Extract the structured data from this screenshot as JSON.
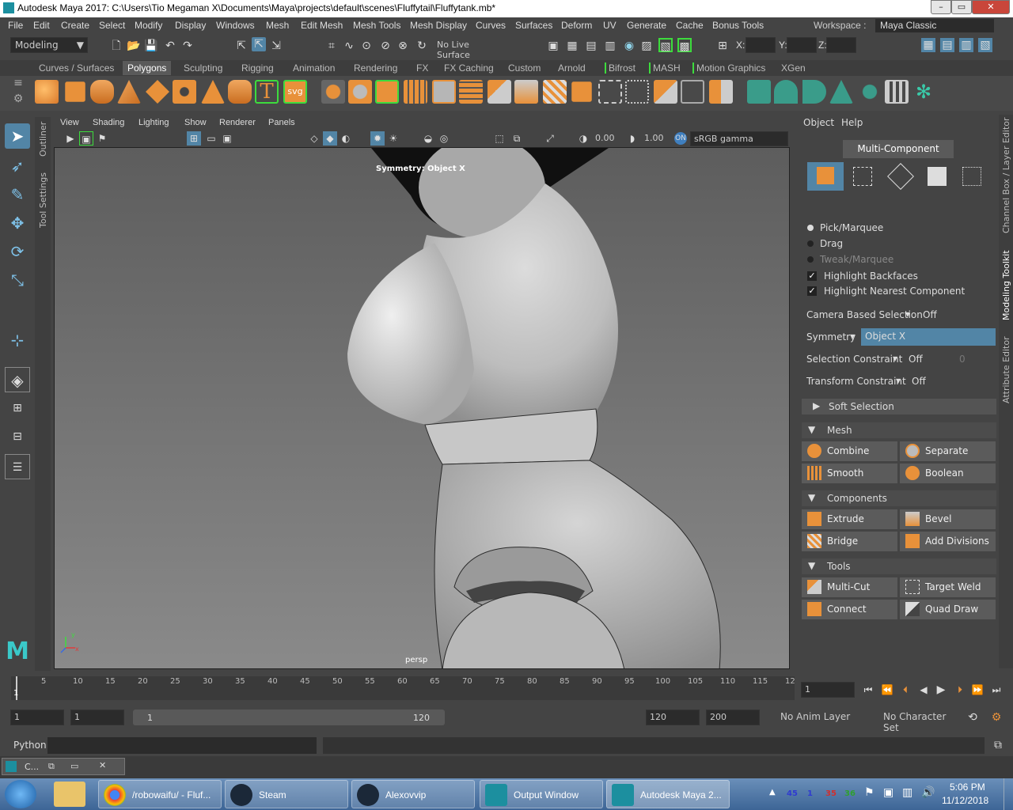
{
  "window": {
    "title": "Autodesk Maya 2017: C:\\Users\\Tio Megaman X\\Documents\\Maya\\projects\\default\\scenes\\Fluffytail\\Fluffytank.mb*",
    "min": "–",
    "max": "▭",
    "close": "✕"
  },
  "menus": [
    "File",
    "Edit",
    "Create",
    "Select",
    "Modify",
    "Display",
    "Windows",
    "Mesh",
    "Edit Mesh",
    "Mesh Tools",
    "Mesh Display",
    "Curves",
    "Surfaces",
    "Deform",
    "UV",
    "Generate",
    "Cache",
    "Bonus Tools"
  ],
  "workspace": {
    "label": "Workspace :",
    "value": "Maya Classic"
  },
  "statusline": {
    "mode": "Modeling",
    "live_surface": "No Live Surface",
    "x_label": "X:",
    "y_label": "Y:",
    "z_label": "Z:"
  },
  "shelf_tabs": [
    "Curves / Surfaces",
    "Polygons",
    "Sculpting",
    "Rigging",
    "Animation",
    "Rendering",
    "FX",
    "FX Caching",
    "Custom",
    "Arnold",
    "Bifrost",
    "MASH",
    "Motion Graphics",
    "XGen"
  ],
  "shelf_active": "Polygons",
  "shelf_text_icons": {
    "text_tool": "T",
    "svg_tool": "svg"
  },
  "side_tabs": {
    "outliner": "Outliner",
    "tool_settings": "Tool Settings"
  },
  "viewport": {
    "menus": [
      "View",
      "Shading",
      "Lighting",
      "Show",
      "Renderer",
      "Panels"
    ],
    "exposure": "0.00",
    "gamma": "1.00",
    "colorspace": "sRGB gamma",
    "symmetry_hud": "Symmetry: Object X",
    "camera_label": "persp",
    "axis_x": "x",
    "axis_y": "y"
  },
  "panel": {
    "menus": [
      "Object",
      "Help"
    ],
    "multi_component": "Multi-Component",
    "pick_marquee": "Pick/Marquee",
    "drag": "Drag",
    "tweak_marquee": "Tweak/Marquee",
    "highlight_backfaces": "Highlight Backfaces",
    "highlight_nearest": "Highlight Nearest Component",
    "camera_based_selection": "Camera Based Selection",
    "camera_based_value": "Off",
    "symmetry": "Symmetry",
    "symmetry_value": "Object X",
    "selection_constraint": "Selection Constraint",
    "selection_constraint_value": "Off",
    "selection_constraint_num": "0",
    "transform_constraint": "Transform Constraint",
    "transform_constraint_value": "Off",
    "soft_selection": "Soft Selection",
    "mesh_header": "Mesh",
    "combine": "Combine",
    "separate": "Separate",
    "smooth": "Smooth",
    "boolean": "Boolean",
    "components_header": "Components",
    "extrude": "Extrude",
    "bevel": "Bevel",
    "bridge": "Bridge",
    "add_divisions": "Add Divisions",
    "tools_header": "Tools",
    "multi_cut": "Multi-Cut",
    "target_weld": "Target Weld",
    "connect": "Connect",
    "quad_draw": "Quad Draw"
  },
  "right_tabs": {
    "channel_box": "Channel Box / Layer Editor",
    "modeling_toolkit": "Modeling Toolkit",
    "attribute_editor": "Attribute Editor"
  },
  "timeline": {
    "ticks": [
      "5",
      "10",
      "15",
      "20",
      "25",
      "30",
      "35",
      "40",
      "45",
      "50",
      "55",
      "60",
      "65",
      "70",
      "75",
      "80",
      "85",
      "90",
      "95",
      "100",
      "105",
      "110",
      "115",
      "12"
    ],
    "current_marker": "1",
    "current_frame": "1"
  },
  "range": {
    "start": "1",
    "start2": "1",
    "slider_start": "1",
    "slider_end": "120",
    "end": "120",
    "end2": "200",
    "anim_layer": "No Anim Layer",
    "char_set": "No Character Set"
  },
  "cmdline": {
    "label": "Python"
  },
  "helpline": {
    "title": "C..."
  },
  "taskbar": {
    "tasks": [
      {
        "label": "/robowaifu/ - Fluf..."
      },
      {
        "label": "Steam"
      },
      {
        "label": "Alexovvip"
      },
      {
        "label": "Output Window"
      },
      {
        "label": "Autodesk Maya 2..."
      }
    ],
    "tray_numbers": [
      "45",
      "1",
      "35",
      "36"
    ],
    "time": "5:06 PM",
    "date": "11/12/2018"
  },
  "colors": {
    "accent_blue": "#5285a6",
    "maya_orange": "#e8913a",
    "green_bracket": "#3ddc3d"
  }
}
